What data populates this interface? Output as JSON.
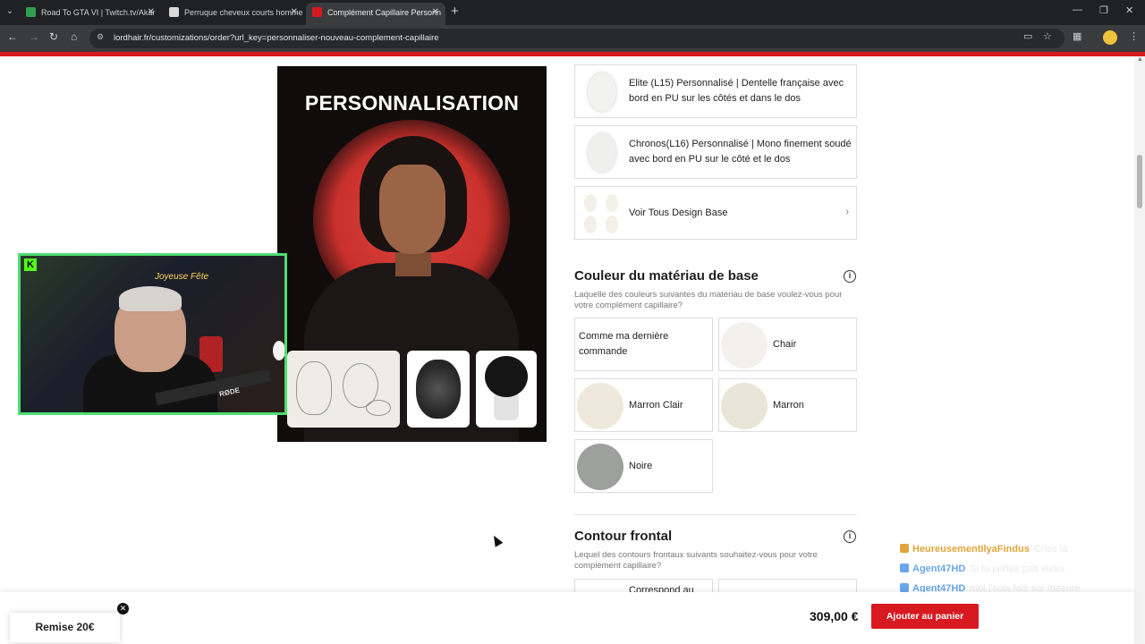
{
  "browser": {
    "tabs": [
      {
        "title": "Road To GTA VI | Twitch.tv/Akar",
        "favicon_color": "#2e9e4f"
      },
      {
        "title": "Perruque cheveux courts homme",
        "favicon_color": "#d9d9d9"
      },
      {
        "title": "Complément Capillaire Personn",
        "favicon_color": "#d71920"
      }
    ],
    "url": "lordhair.fr/customizations/order?url_key=personnaliser-nouveau-complement-capillaire",
    "new_tab_symbol": "+"
  },
  "hero": {
    "title": "PERSONNALISATION"
  },
  "base_design": {
    "options": [
      {
        "label": "Elite (L15) Personnalisé | Dentelle française avec bord en PU sur les côtés et dans le dos",
        "swatch": "#f2f2f0"
      },
      {
        "label": "Chronos(L16) Personnalisé | Mono finement soudé avec bord en PU sur le côté et le dos",
        "swatch": "#efefed"
      },
      {
        "label": "Voir Tous Design Base",
        "swatch": "#f3f0e8"
      }
    ]
  },
  "base_color": {
    "title": "Couleur du matériau de base",
    "description": "Laquelle des couleurs suivantes du matériau de base voulez-vous pour votre complément capillaire?",
    "options": [
      {
        "label": "Comme ma dernière commande",
        "swatch": ""
      },
      {
        "label": "Chair",
        "swatch": "#f3f1ec"
      },
      {
        "label": "Marron Clair",
        "swatch": "#efe9dd"
      },
      {
        "label": "Marron",
        "swatch": "#e9e5d8"
      },
      {
        "label": "Noire",
        "swatch": "#9ea09e"
      }
    ]
  },
  "front_contour": {
    "title": "Contour frontal",
    "description": "Lequel des contours frontaux suivants souhaitez-vous pour votre complément capillaire?",
    "partial_option": "Correspond au"
  },
  "chat": [
    {
      "user": "HeureusementIlyaFindus",
      "message": "Cries là",
      "color": "#e0a43a"
    },
    {
      "user": "Agent47HD",
      "message": "Si tu portes pas euais",
      "color": "#6aa6e8"
    },
    {
      "user": "Agent47HD",
      "message": "moi j'suis fais sur mesure",
      "color": "#6aa6e8"
    }
  ],
  "bottom": {
    "promo": "Remise 20€",
    "price": "309,00 €",
    "add_to_cart": "Ajouter au panier"
  },
  "webcam": {
    "neon_text": "Joyeuse Fête",
    "mic_brand": "RØDE"
  },
  "colors": {
    "brand_red": "#d71920",
    "webcam_border": "#4dde72"
  }
}
